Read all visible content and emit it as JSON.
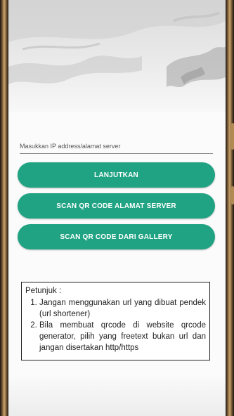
{
  "colors": {
    "accent": "#20a383",
    "background": "#fbfbfb",
    "hint_border": "#222222"
  },
  "form": {
    "ip_placeholder": "Masukkan IP address/alamat server",
    "ip_value": ""
  },
  "buttons": {
    "continue": "LANJUTKAN",
    "scan_server": "SCAN QR CODE ALAMAT SERVER",
    "scan_gallery": "SCAN QR CODE DARI GALLERY"
  },
  "hint": {
    "title": "Petunjuk :",
    "items": [
      "Jangan menggunakan url yang dibuat pendek (url shortener)",
      "Bila membuat qrcode di website qrcode generator, pilih yang freetext bukan url dan jangan disertakan http/https"
    ]
  }
}
